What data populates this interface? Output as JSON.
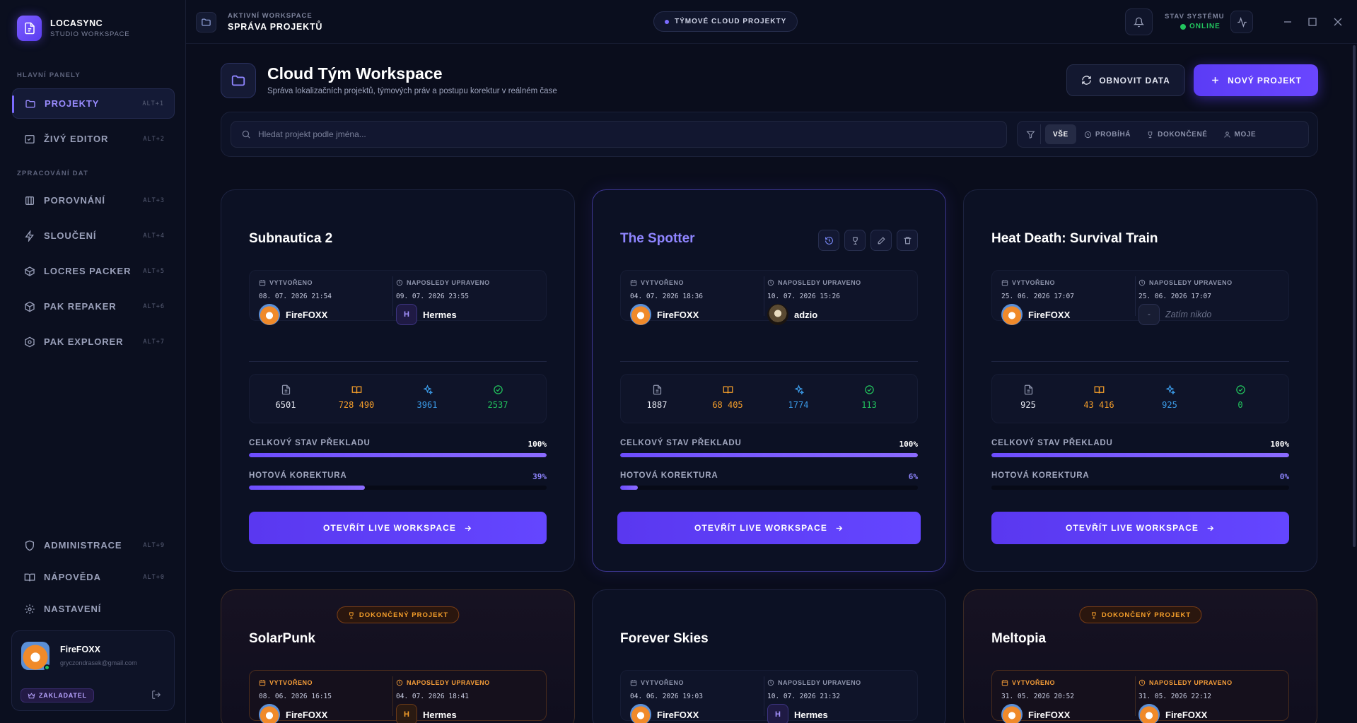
{
  "app": {
    "name": "LOCASYNC",
    "subtitle": "STUDIO WORKSPACE"
  },
  "sidebar": {
    "section_main": "HLAVNÍ PANELY",
    "section_data": "ZPRACOVÁNÍ DAT",
    "items": [
      {
        "label": "PROJEKTY",
        "shortcut": "ALT+1",
        "icon": "folder-icon",
        "active": true
      },
      {
        "label": "ŽIVÝ EDITOR",
        "shortcut": "ALT+2",
        "icon": "edit-icon"
      },
      {
        "label": "POROVNÁNÍ",
        "shortcut": "ALT+3",
        "icon": "compare-icon"
      },
      {
        "label": "SLOUČENÍ",
        "shortcut": "ALT+4",
        "icon": "lightning-icon"
      },
      {
        "label": "LOCRES PACKER",
        "shortcut": "ALT+5",
        "icon": "box-icon"
      },
      {
        "label": "PAK REPAKER",
        "shortcut": "ALT+6",
        "icon": "cube-icon"
      },
      {
        "label": "PAK EXPLORER",
        "shortcut": "ALT+7",
        "icon": "globe-icon"
      }
    ],
    "bottom_items": [
      {
        "label": "ADMINISTRACE",
        "shortcut": "ALT+9",
        "icon": "shield-icon"
      },
      {
        "label": "NÁPOVĚDA",
        "shortcut": "ALT+0",
        "icon": "book-icon"
      },
      {
        "label": "NASTAVENÍ",
        "icon": "gear-icon"
      }
    ],
    "user": {
      "name": "FireFOXX",
      "email": "gryczondrasek@gmail.com",
      "role": "ZAKLADATEL"
    }
  },
  "topbar": {
    "workspace_label": "AKTIVNÍ WORKSPACE",
    "workspace_name": "SPRÁVA PROJEKTŮ",
    "cloud_pill": "TÝMOVÉ CLOUD PROJEKTY",
    "status_label": "STAV SYSTÉMU",
    "status_value": "ONLINE"
  },
  "header": {
    "title": "Cloud Tým Workspace",
    "subtitle": "Správa lokalizačních projektů, týmových práv a postupu korektur v reálném čase",
    "refresh_label": "OBNOVIT DATA",
    "new_label": "NOVÝ PROJEKT"
  },
  "filters": {
    "search_placeholder": "Hledat projekt podle jména...",
    "tabs": [
      "VŠE",
      "PROBÍHÁ",
      "DOKONČENÉ",
      "MOJE"
    ],
    "active": "VŠE"
  },
  "labels": {
    "created": "VYTVOŘENO",
    "updated": "NAPOSLEDY UPRAVENO",
    "total": "CELKOVÝ STAV PŘEKLADU",
    "proof": "HOTOVÁ KOREKTURA",
    "open": "OTEVŘÍT LIVE WORKSPACE",
    "done_badge": "DOKONČENÝ PROJEKT",
    "nobody": "Zatím nikdo"
  },
  "colors": {
    "accent": "#6446ff",
    "online": "#22c55e",
    "orange": "#f59e2a",
    "blue": "#3b9be8",
    "green": "#22c55e"
  },
  "projects": [
    {
      "name": "Subnautica 2",
      "created": "08. 07. 2026 21:54",
      "created_by": "FireFOXX",
      "updated": "09. 07. 2026 23:55",
      "updated_by": "Hermes",
      "stats": [
        "6501",
        "728 490",
        "3961",
        "2537"
      ],
      "total": "100%",
      "total_pct": 100,
      "proof": "39%",
      "proof_pct": 39
    },
    {
      "name": "The Spotter",
      "created": "04. 07. 2026 18:36",
      "created_by": "FireFOXX",
      "updated": "10. 07. 2026 15:26",
      "updated_by": "adzio",
      "stats": [
        "1887",
        "68 405",
        "1774",
        "113"
      ],
      "total": "100%",
      "total_pct": 100,
      "proof": "6%",
      "proof_pct": 6
    },
    {
      "name": "Heat Death: Survival Train",
      "created": "25. 06. 2026 17:07",
      "created_by": "FireFOXX",
      "updated": "25. 06. 2026 17:07",
      "updated_by": "",
      "stats": [
        "925",
        "43 416",
        "925",
        "0"
      ],
      "total": "100%",
      "total_pct": 100,
      "proof": "0%",
      "proof_pct": 0
    },
    {
      "name": "SolarPunk",
      "created": "08. 06. 2026 16:15",
      "created_by": "FireFOXX",
      "updated": "04. 07. 2026 18:41",
      "updated_by": "Hermes"
    },
    {
      "name": "Forever Skies",
      "created": "04. 06. 2026 19:03",
      "created_by": "FireFOXX",
      "updated": "10. 07. 2026 21:32",
      "updated_by": "Hermes"
    },
    {
      "name": "Meltopia",
      "created": "31. 05. 2026 20:52",
      "created_by": "FireFOXX",
      "updated": "31. 05. 2026 22:12",
      "updated_by": "FireFOXX"
    }
  ]
}
